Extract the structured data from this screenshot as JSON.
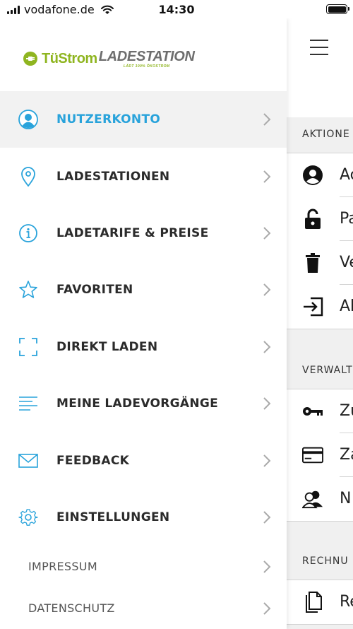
{
  "status_bar": {
    "carrier": "vodafone.de",
    "time": "14:30"
  },
  "logo": {
    "brand_left": "TüStrom",
    "brand_right": "LADESTATION",
    "tagline": "LÄDT 100% ÖKOSTROM"
  },
  "menu": {
    "items": [
      {
        "label": "NUTZERKONTO",
        "icon": "user-icon",
        "active": true
      },
      {
        "label": "LADESTATIONEN",
        "icon": "location-pin-icon"
      },
      {
        "label": "LADETARIFE & PREISE",
        "icon": "info-icon"
      },
      {
        "label": "FAVORITEN",
        "icon": "star-icon"
      },
      {
        "label": "DIREKT LADEN",
        "icon": "scan-frame-icon"
      },
      {
        "label": "MEINE LADEVORGÄNGE",
        "icon": "list-icon"
      },
      {
        "label": "FEEDBACK",
        "icon": "envelope-icon"
      },
      {
        "label": "EINSTELLUNGEN",
        "icon": "gear-icon"
      }
    ],
    "sub_items": [
      {
        "label": "IMPRESSUM"
      },
      {
        "label": "DATENSCHUTZ"
      }
    ]
  },
  "background_page": {
    "sections": [
      {
        "title": "AKTIONE",
        "rows": [
          {
            "text": "Ac",
            "icon": "account-icon"
          },
          {
            "text": "Pa",
            "icon": "lock-icon"
          },
          {
            "text": "Ve",
            "icon": "trash-icon"
          },
          {
            "text": "Ab",
            "icon": "logout-icon"
          }
        ]
      },
      {
        "title": "VERWALT",
        "rows": [
          {
            "text": "Zu",
            "icon": "key-icon"
          },
          {
            "text": "Za",
            "icon": "credit-card-icon"
          },
          {
            "text": "N",
            "icon": "users-icon"
          }
        ]
      },
      {
        "title": "RECHNU",
        "rows": [
          {
            "text": "Re",
            "icon": "document-icon"
          }
        ]
      }
    ]
  },
  "colors": {
    "accent": "#29a3db",
    "brand_green": "#8fb520",
    "brand_gray": "#6e6e6e"
  }
}
